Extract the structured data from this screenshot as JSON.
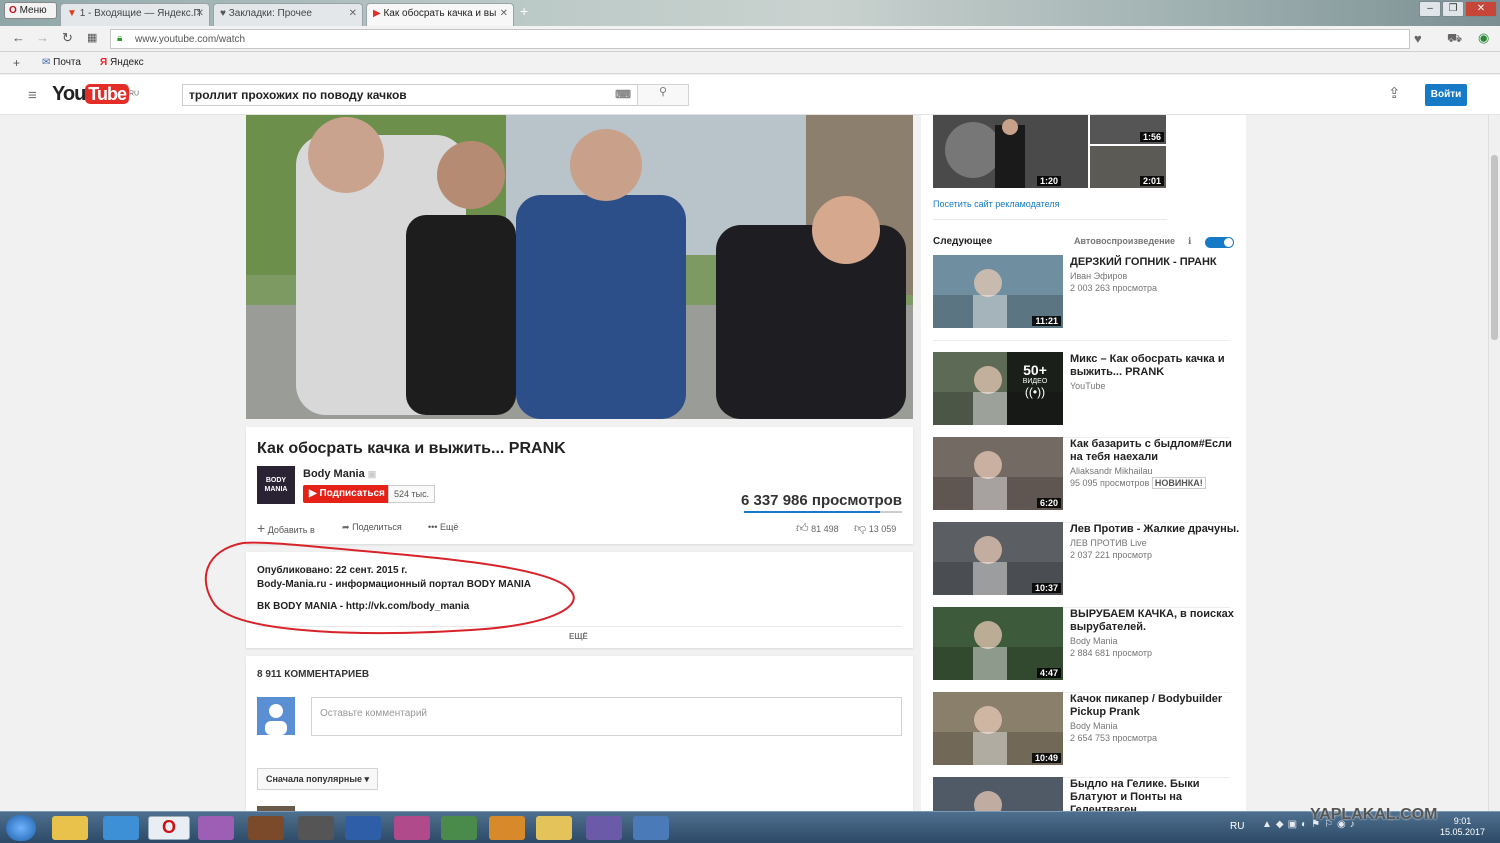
{
  "browser": {
    "menu_label": "Меню",
    "tabs": [
      {
        "label": "1 - Входящие — Яндекс.П",
        "close": "✕"
      },
      {
        "label": "Закладки: Прочее",
        "close": "✕"
      },
      {
        "label": "Как обосрать качка и вы",
        "close": "✕"
      }
    ],
    "new_tab": "+",
    "url": "www.youtube.com/watch",
    "bookmarks": [
      {
        "label": "Почта"
      },
      {
        "label": "Яндекс"
      }
    ],
    "bookmark_add": "+"
  },
  "masthead": {
    "logo_you": "You",
    "logo_tube": "Tube",
    "logo_region": "RU",
    "search_value": "троллит прохожих по поводу качков",
    "login_label": "Войти"
  },
  "video": {
    "title": "Как обосрать качка и выжить... PRANK",
    "channel": "Body Mania",
    "channel_logo_text": "BODY MANIA",
    "subscribe_label": "Подписаться",
    "subscribers": "524 тыс.",
    "views": "6 337 986 просмотров",
    "add_label": "Добавить в",
    "share_label": "Поделиться",
    "more_label": "Ещё",
    "likes": "81 498",
    "dislikes": "13 059",
    "published": "Опубликовано: 22 сент. 2015 г.",
    "desc_line1": "Body-Mania.ru - информационный портал BODY MANIA",
    "desc_line2": "ВК BODY MANIA - http://vk.com/body_mania",
    "show_more": "ЕЩЁ",
    "comments_count": "8 911 КОММЕНТАРИЕВ",
    "comment_placeholder": "Оставьте комментарий",
    "sort_label": "Сначала популярные"
  },
  "sidebar": {
    "ad_durations": [
      "1:56",
      "1:20",
      "2:01"
    ],
    "ad_link": "Посетить сайт рекламодателя",
    "next_label": "Следующее",
    "autoplay_label": "Автовоспроизведение",
    "related": [
      {
        "title": "ДЕРЗКИЙ ГОПНИК - ПРАНК",
        "channel": "Иван Эфиров",
        "views": "2 003 263 просмотра",
        "duration": "11:21",
        "color": "#6f8fa0"
      },
      {
        "title": "Микс – Как обосрать качка и выжить... PRANK",
        "channel": "YouTube",
        "views": "",
        "duration": "",
        "mix_count": "50+",
        "mix_label": "ВИДЕО",
        "color": "#5d6a56"
      },
      {
        "title": "Как базарить с быдлом#Если на тебя наехали",
        "channel": "Aliaksandr Mikhailau",
        "views": "95 095 просмотров",
        "badge": "НОВИНКА!",
        "duration": "6:20",
        "color": "#746a64"
      },
      {
        "title": "Лев Против - Жалкие драчуны.",
        "channel": "ЛЕВ ПРОТИВ Live",
        "views": "2 037 221 просмотр",
        "duration": "10:37",
        "color": "#5b5e63"
      },
      {
        "title": "ВЫРУБАЕМ КАЧКА, в поисках вырубателей.",
        "channel": "Body Mania",
        "views": "2 884 681 просмотр",
        "duration": "4:47",
        "color": "#3d5a3a"
      },
      {
        "title": "Качок пикапер / Bodybuilder Pickup Prank",
        "channel": "Body Mania",
        "views": "2 654 753 просмотра",
        "duration": "10:49",
        "color": "#8a7f6b"
      },
      {
        "title": "Быдло на Гелике. Быки Блатуют и Понты на Гелентваген",
        "channel": "",
        "views": "",
        "duration": "",
        "color": "#4f5a66"
      }
    ]
  },
  "taskbar": {
    "lang": "RU",
    "time": "9:01",
    "date": "15.05.2017",
    "watermark": "YAPLAKAL.COM"
  }
}
